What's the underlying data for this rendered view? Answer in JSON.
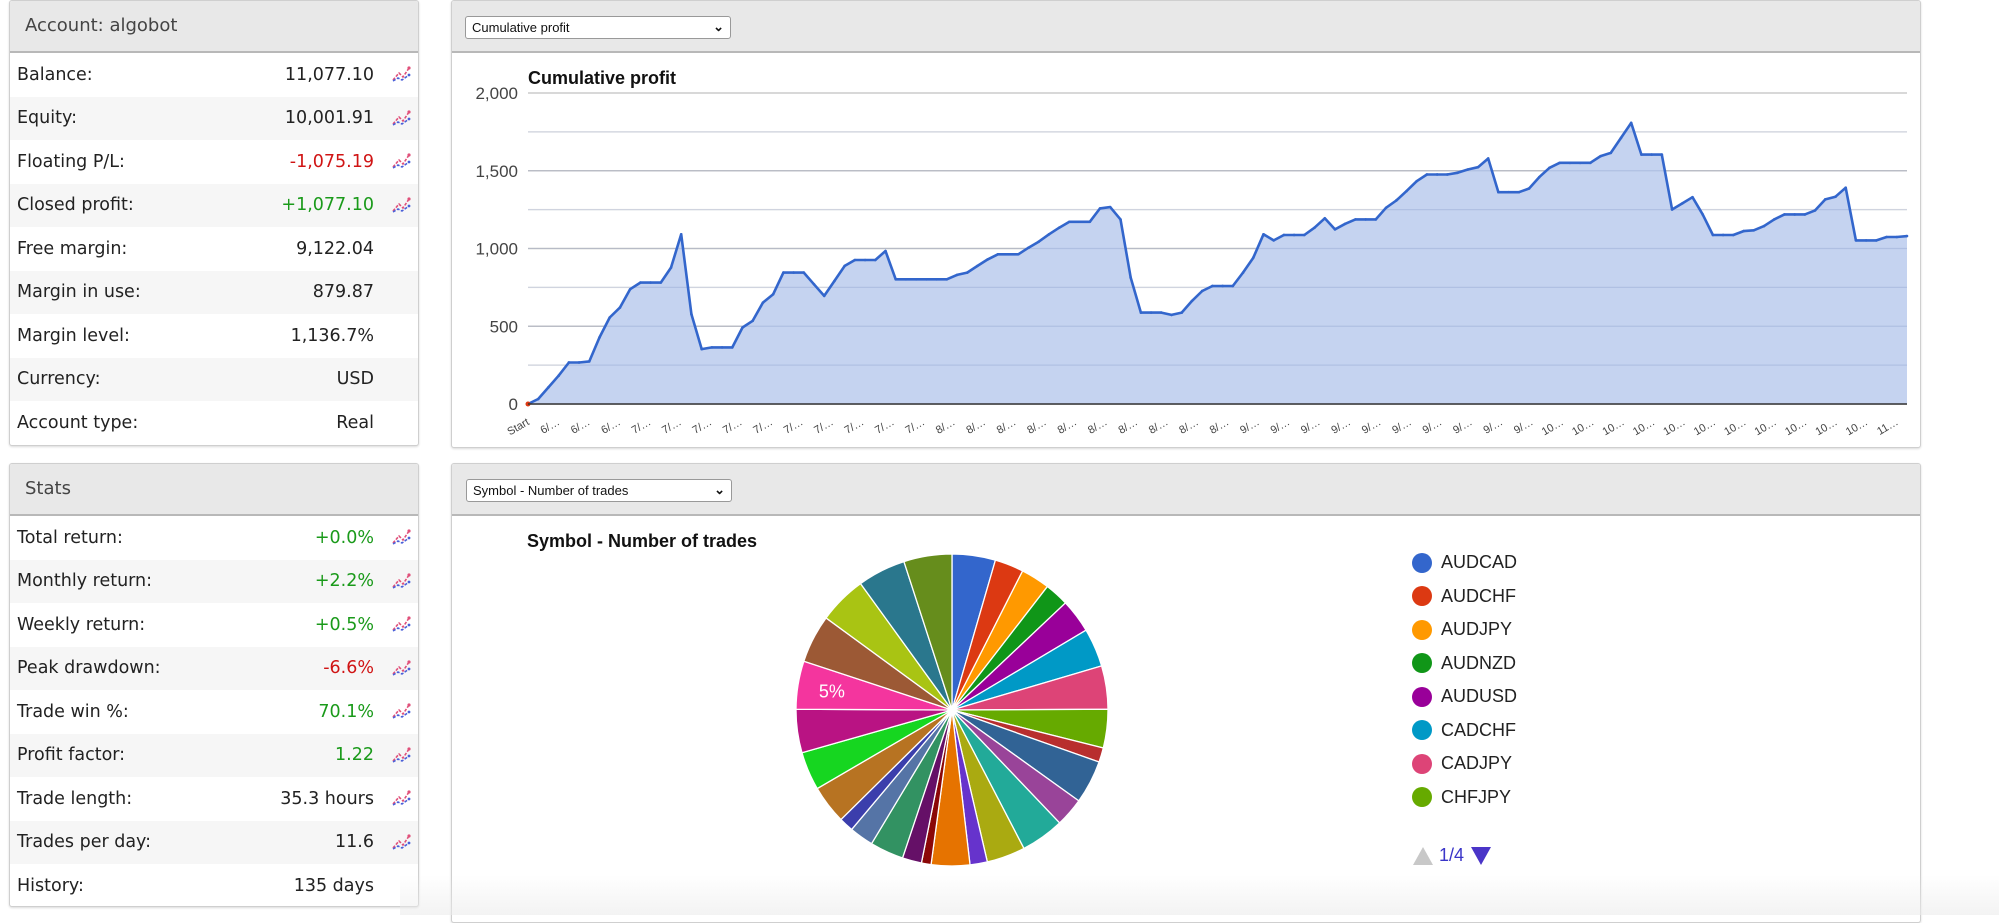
{
  "account": {
    "title": "Account: algobot",
    "rows": [
      {
        "label": "Balance:",
        "value": "11,077.10",
        "tone": "",
        "icon": true
      },
      {
        "label": "Equity:",
        "value": "10,001.91",
        "tone": "",
        "icon": true
      },
      {
        "label": "Floating P/L:",
        "value": "-1,075.19",
        "tone": "neg",
        "icon": true
      },
      {
        "label": "Closed profit:",
        "value": "+1,077.10",
        "tone": "pos",
        "icon": true
      },
      {
        "label": "Free margin:",
        "value": "9,122.04",
        "tone": "",
        "icon": false
      },
      {
        "label": "Margin in use:",
        "value": "879.87",
        "tone": "",
        "icon": false
      },
      {
        "label": "Margin level:",
        "value": "1,136.7%",
        "tone": "",
        "icon": false
      },
      {
        "label": "Currency:",
        "value": "USD",
        "tone": "",
        "icon": false
      },
      {
        "label": "Account type:",
        "value": "Real",
        "tone": "",
        "icon": false
      }
    ]
  },
  "stats": {
    "title": "Stats",
    "rows": [
      {
        "label": "Total return:",
        "value": "+0.0%",
        "tone": "pos",
        "icon": true
      },
      {
        "label": "Monthly return:",
        "value": "+2.2%",
        "tone": "pos",
        "icon": true
      },
      {
        "label": "Weekly return:",
        "value": "+0.5%",
        "tone": "pos",
        "icon": true
      },
      {
        "label": "Peak drawdown:",
        "value": "-6.6%",
        "tone": "neg",
        "icon": true
      },
      {
        "label": "Trade win %:",
        "value": "70.1%",
        "tone": "pos",
        "icon": true
      },
      {
        "label": "Profit factor:",
        "value": "1.22",
        "tone": "pos",
        "icon": true
      },
      {
        "label": "Trade length:",
        "value": "35.3 hours",
        "tone": "",
        "icon": true
      },
      {
        "label": "Trades per day:",
        "value": "11.6",
        "tone": "",
        "icon": true
      },
      {
        "label": "History:",
        "value": "135 days",
        "tone": "",
        "icon": false
      }
    ]
  },
  "colors": {
    "positive": "#1a9a1a",
    "negative": "#d01414",
    "line": "#3366cc",
    "area": "#c2d1ef"
  },
  "profit_panel": {
    "select_value": "Cumulative profit"
  },
  "pie_panel": {
    "select_value": "Symbol - Number of trades",
    "pager": "1/4"
  },
  "chart_data": [
    {
      "type": "area",
      "title": "Cumulative profit",
      "ylim": [
        0,
        2000
      ],
      "yticks": [
        "0",
        "500",
        "1,000",
        "1,500",
        "2,000"
      ],
      "ytick_values": [
        0,
        500,
        1000,
        1500,
        2000
      ],
      "grid": true,
      "xlabels": [
        "Start",
        "6/…",
        "6/…",
        "6/…",
        "7/…",
        "7/…",
        "7/…",
        "7/…",
        "7/…",
        "7/…",
        "7/…",
        "7/…",
        "7/…",
        "7/…",
        "8/…",
        "8/…",
        "8/…",
        "8/…",
        "8/…",
        "8/…",
        "8/…",
        "8/…",
        "8/…",
        "8/…",
        "9/…",
        "9/…",
        "9/…",
        "9/…",
        "9/…",
        "9/…",
        "9/…",
        "9/…",
        "9/…",
        "9/…",
        "10…",
        "10…",
        "10…",
        "10…",
        "10…",
        "10…",
        "10…",
        "10…",
        "10…",
        "10…",
        "10…",
        "11…"
      ],
      "values": [
        0,
        32,
        107,
        182,
        267,
        267,
        274,
        428,
        556,
        620,
        738,
        781,
        781,
        781,
        877,
        1091,
        578,
        353,
        364,
        364,
        364,
        492,
        535,
        652,
        706,
        845,
        845,
        845,
        770,
        695,
        791,
        888,
        926,
        926,
        926,
        984,
        802,
        802,
        802,
        802,
        802,
        802,
        830,
        845,
        888,
        930,
        963,
        963,
        963,
        1005,
        1044,
        1091,
        1134,
        1172,
        1172,
        1172,
        1258,
        1266,
        1187,
        813,
        588,
        588,
        588,
        573,
        588,
        663,
        727,
        759,
        759,
        759,
        845,
        941,
        1091,
        1052,
        1087,
        1087,
        1087,
        1134,
        1194,
        1123,
        1159,
        1187,
        1187,
        1187,
        1262,
        1309,
        1369,
        1433,
        1476,
        1476,
        1476,
        1487,
        1508,
        1523,
        1579,
        1362,
        1362,
        1362,
        1386,
        1459,
        1519,
        1551,
        1551,
        1551,
        1551,
        1594,
        1615,
        1711,
        1808,
        1604,
        1604,
        1604,
        1251,
        1290,
        1330,
        1219,
        1087,
        1087,
        1087,
        1112,
        1117,
        1144,
        1187,
        1219,
        1219,
        1219,
        1245,
        1316,
        1333,
        1391,
        1052,
        1052,
        1052,
        1074,
        1074,
        1080
      ]
    },
    {
      "type": "pie",
      "title": "Symbol - Number of trades",
      "legend": "right",
      "slice_label": "5%",
      "slice_label_index": 23,
      "slices": [
        {
          "name": "AUDCAD",
          "percent": 4.5,
          "color": "#3366cc"
        },
        {
          "name": "AUDCHF",
          "percent": 3.0,
          "color": "#dc3912"
        },
        {
          "name": "AUDJPY",
          "percent": 3.0,
          "color": "#ff9900"
        },
        {
          "name": "AUDNZD",
          "percent": 2.5,
          "color": "#109618"
        },
        {
          "name": "AUDUSD",
          "percent": 3.5,
          "color": "#990099"
        },
        {
          "name": "CADCHF",
          "percent": 4.0,
          "color": "#0099c6"
        },
        {
          "name": "CADJPY",
          "percent": 4.5,
          "color": "#dd4477"
        },
        {
          "name": "CHFJPY",
          "percent": 4.0,
          "color": "#66aa00"
        },
        {
          "percent": 1.5,
          "color": "#b82e2e"
        },
        {
          "percent": 4.5,
          "color": "#316395"
        },
        {
          "percent": 3.0,
          "color": "#994499"
        },
        {
          "percent": 4.5,
          "color": "#22aa99"
        },
        {
          "percent": 4.0,
          "color": "#aaaa11"
        },
        {
          "percent": 1.8,
          "color": "#6633cc"
        },
        {
          "percent": 4.0,
          "color": "#e67300"
        },
        {
          "percent": 1.0,
          "color": "#8b0707"
        },
        {
          "percent": 2.0,
          "color": "#651067"
        },
        {
          "percent": 3.5,
          "color": "#329262"
        },
        {
          "percent": 2.5,
          "color": "#5574a6"
        },
        {
          "percent": 1.5,
          "color": "#3b3eac"
        },
        {
          "percent": 4.0,
          "color": "#b77322"
        },
        {
          "percent": 4.0,
          "color": "#16d620"
        },
        {
          "percent": 4.5,
          "color": "#b91383"
        },
        {
          "percent": 5.0,
          "color": "#f4359e"
        },
        {
          "percent": 5.0,
          "color": "#9c5935"
        },
        {
          "percent": 5.0,
          "color": "#a9c413"
        },
        {
          "percent": 5.0,
          "color": "#2a778d"
        },
        {
          "percent": 5.0,
          "color": "#668d1c"
        }
      ]
    }
  ]
}
